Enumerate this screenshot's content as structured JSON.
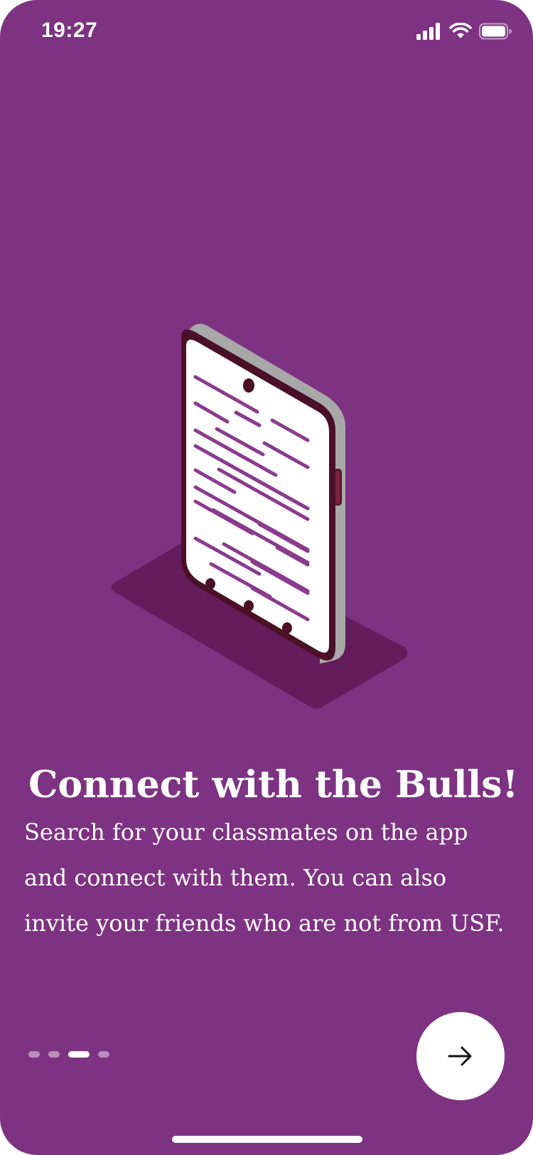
{
  "status_bar": {
    "time": "19:27",
    "icons": [
      "signal-icon",
      "wifi-icon",
      "battery-icon"
    ]
  },
  "illustration": {
    "name": "phone-illustration",
    "colors": {
      "background": "#7e3282",
      "shadow": "#641c5c",
      "phone_edge": "#a8a8a8",
      "phone_bezel": "#4a1026",
      "screen": "#ffffff",
      "lines": "#8a3b8e",
      "side_button": "#7a2040"
    }
  },
  "onboarding": {
    "title": "Connect with the Bulls!",
    "description": "Search for your classmates on the app and connect with them. You can also invite your friends who are not from USF."
  },
  "pager": {
    "total": 4,
    "active_index": 2
  },
  "next_button": {
    "icon": "arrow-right-icon"
  },
  "colors": {
    "accent": "#7e3282",
    "text": "#ffffff"
  }
}
